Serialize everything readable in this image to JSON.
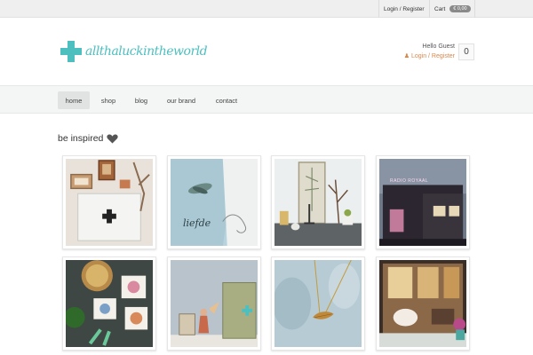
{
  "topbar": {
    "login_register": "Login / Register",
    "cart_label": "Cart",
    "cart_amount": "€ 0,00"
  },
  "header": {
    "logo_text": "allthaluckintheworld",
    "hello": "Hello Guest",
    "login_register": "Login / Register",
    "cart_count": "0"
  },
  "nav": {
    "items": [
      {
        "label": "home",
        "active": true
      },
      {
        "label": "shop"
      },
      {
        "label": "blog"
      },
      {
        "label": "our brand"
      },
      {
        "label": "contact"
      }
    ]
  },
  "main": {
    "heading": "be inspired",
    "gallery": [
      {
        "name": "cabinet-with-frames",
        "caption": ""
      },
      {
        "name": "moth-fabric-liefde",
        "caption": "liefde"
      },
      {
        "name": "botanical-shelf",
        "caption": ""
      },
      {
        "name": "radio-royaal-building",
        "caption": "RADIO ROYAAL"
      },
      {
        "name": "bowl-and-cards",
        "caption": ""
      },
      {
        "name": "green-cabinet-figurine",
        "caption": ""
      },
      {
        "name": "leaf-necklace",
        "caption": ""
      },
      {
        "name": "shop-window-interior",
        "caption": ""
      }
    ]
  },
  "colors": {
    "accent": "#4dbfbf",
    "link": "#d9874a",
    "nav_bg": "#f3f6f5"
  }
}
